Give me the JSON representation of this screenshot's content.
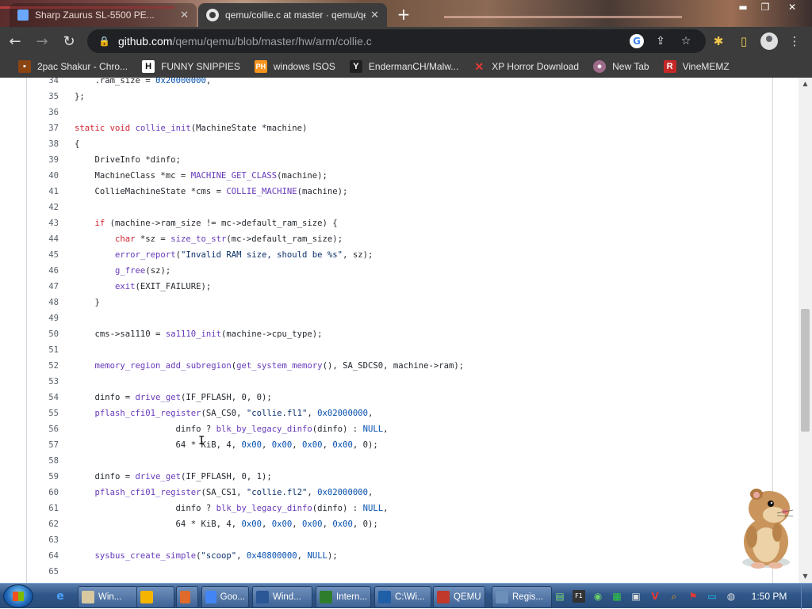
{
  "browser": {
    "tabs": [
      {
        "title": "Sharp Zaurus SL-5500 PE...",
        "active": false
      },
      {
        "title": "qemu/collie.c at master · qemu/qe...",
        "active": true
      }
    ],
    "url_host": "github.com",
    "url_path": "/qemu/qemu/blob/master/hw/arm/collie.c",
    "bookmarks": [
      {
        "label": "2pac Shakur - Chro...",
        "icon": "bookmark-favicon"
      },
      {
        "label": "FUNNY SNIPPIES",
        "icon": "H"
      },
      {
        "label": "windows ISOS",
        "icon": "PH"
      },
      {
        "label": "EndermanCH/Malw...",
        "icon": "Y"
      },
      {
        "label": "XP Horror Download",
        "icon": "X"
      },
      {
        "label": "New Tab",
        "icon": "globe"
      },
      {
        "label": "VineMEMZ",
        "icon": "R"
      }
    ]
  },
  "code": {
    "lines": [
      {
        "n": "34",
        "t": "    .ram_size = 0x20000000,"
      },
      {
        "n": "35",
        "t": "};"
      },
      {
        "n": "36",
        "t": ""
      },
      {
        "n": "37",
        "t": "static void collie_init(MachineState *machine)"
      },
      {
        "n": "38",
        "t": "{"
      },
      {
        "n": "39",
        "t": "    DriveInfo *dinfo;"
      },
      {
        "n": "40",
        "t": "    MachineClass *mc = MACHINE_GET_CLASS(machine);"
      },
      {
        "n": "41",
        "t": "    CollieMachineState *cms = COLLIE_MACHINE(machine);"
      },
      {
        "n": "42",
        "t": ""
      },
      {
        "n": "43",
        "t": "    if (machine->ram_size != mc->default_ram_size) {"
      },
      {
        "n": "44",
        "t": "        char *sz = size_to_str(mc->default_ram_size);"
      },
      {
        "n": "45",
        "t": "        error_report(\"Invalid RAM size, should be %s\", sz);"
      },
      {
        "n": "46",
        "t": "        g_free(sz);"
      },
      {
        "n": "47",
        "t": "        exit(EXIT_FAILURE);"
      },
      {
        "n": "48",
        "t": "    }"
      },
      {
        "n": "49",
        "t": ""
      },
      {
        "n": "50",
        "t": "    cms->sa1110 = sa1110_init(machine->cpu_type);"
      },
      {
        "n": "51",
        "t": ""
      },
      {
        "n": "52",
        "t": "    memory_region_add_subregion(get_system_memory(), SA_SDCS0, machine->ram);"
      },
      {
        "n": "53",
        "t": ""
      },
      {
        "n": "54",
        "t": "    dinfo = drive_get(IF_PFLASH, 0, 0);"
      },
      {
        "n": "55",
        "t": "    pflash_cfi01_register(SA_CS0, \"collie.fl1\", 0x02000000,"
      },
      {
        "n": "56",
        "t": "                    dinfo ? blk_by_legacy_dinfo(dinfo) : NULL,"
      },
      {
        "n": "57",
        "t": "                    64 * KiB, 4, 0x00, 0x00, 0x00, 0x00, 0);"
      },
      {
        "n": "58",
        "t": ""
      },
      {
        "n": "59",
        "t": "    dinfo = drive_get(IF_PFLASH, 0, 1);"
      },
      {
        "n": "60",
        "t": "    pflash_cfi01_register(SA_CS1, \"collie.fl2\", 0x02000000,"
      },
      {
        "n": "61",
        "t": "                    dinfo ? blk_by_legacy_dinfo(dinfo) : NULL,"
      },
      {
        "n": "62",
        "t": "                    64 * KiB, 4, 0x00, 0x00, 0x00, 0x00, 0);"
      },
      {
        "n": "63",
        "t": ""
      },
      {
        "n": "64",
        "t": "    sysbus_create_simple(\"scoop\", 0x40800000, NULL);"
      },
      {
        "n": "65",
        "t": ""
      }
    ]
  },
  "taskbar": {
    "tasks": [
      {
        "label": "Win...",
        "color": "#d8c9a0"
      },
      {
        "label": "",
        "color": "#f4b400"
      },
      {
        "label": "",
        "color": "#e06a2c"
      },
      {
        "label": "Goo...",
        "color": "#4285f4"
      },
      {
        "label": "Wind...",
        "color": "#2b5797"
      },
      {
        "label": "Intern...",
        "color": "#2d7d2d"
      },
      {
        "label": "C:\\Wi...",
        "color": "#1f5fa8"
      },
      {
        "label": "QEMU",
        "color": "#c0392b"
      },
      {
        "label": "Regis...",
        "color": "#6b8fb8"
      }
    ],
    "clock": "1:50 PM"
  },
  "colors": {
    "keyword": "#cf222e",
    "function": "#6639ba",
    "string": "#0a3069",
    "constant": "#0550ae",
    "chrome_toolbar": "#3c3c3c"
  }
}
